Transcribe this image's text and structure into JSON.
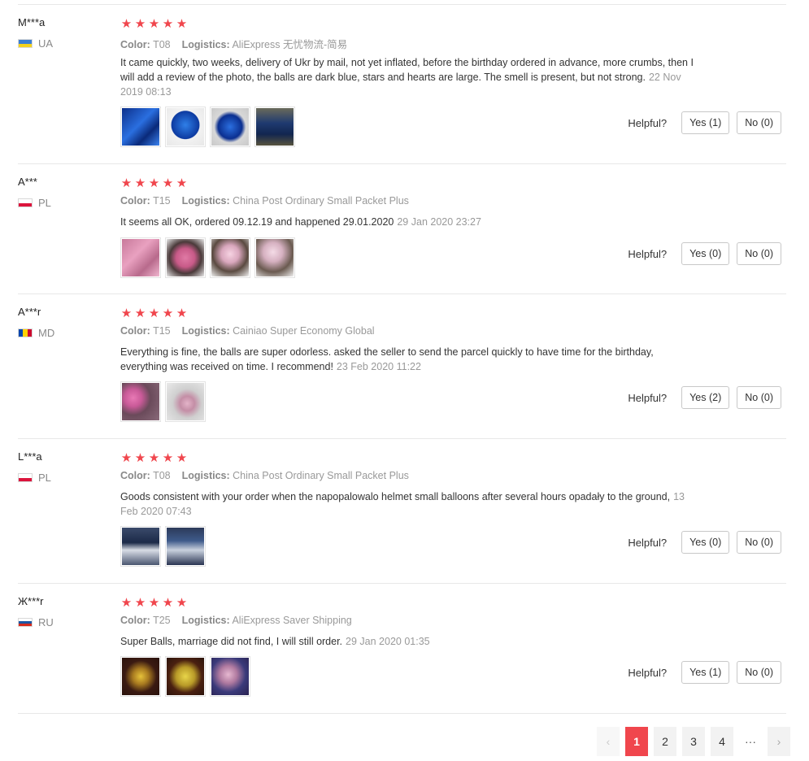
{
  "helpful_label": "Helpful?",
  "color_label": "Color:",
  "logistics_label": "Logistics:",
  "reviews": [
    {
      "user": "M***a",
      "country": "UA",
      "stars": 5,
      "color": "T08",
      "logistics": "AliExpress 无忧物流-简易",
      "text": "It came quickly, two weeks, delivery of Ukr by mail, not yet inflated, before the birthday ordered in advance, more crumbs, then I will add a review of the photo, the balls are dark blue, stars and hearts are large. The smell is present, but not strong.",
      "date": "22 Nov 2019 08:13",
      "yes": "Yes (1)",
      "no": "No (0)"
    },
    {
      "user": "A***",
      "country": "PL",
      "stars": 5,
      "color": "T15",
      "logistics": "China Post Ordinary Small Packet Plus",
      "text": "It seems all OK, ordered 09.12.19 and happened 29.01.2020",
      "date": "29 Jan 2020 23:27",
      "yes": "Yes (0)",
      "no": "No (0)"
    },
    {
      "user": "A***r",
      "country": "MD",
      "stars": 5,
      "color": "T15",
      "logistics": "Cainiao Super Economy Global",
      "text": "Everything is fine, the balls are super odorless. asked the seller to send the parcel quickly to have time for the birthday, everything was received on time. I recommend!",
      "date": "23 Feb 2020 11:22",
      "yes": "Yes (2)",
      "no": "No (0)"
    },
    {
      "user": "L***a",
      "country": "PL",
      "stars": 5,
      "color": "T08",
      "logistics": "China Post Ordinary Small Packet Plus",
      "text": "Goods consistent with your order when the napopalowalo helmet small balloons after several hours opadały to the ground,",
      "date": "13 Feb 2020 07:43",
      "yes": "Yes (0)",
      "no": "No (0)"
    },
    {
      "user": "Ж***r",
      "country": "RU",
      "stars": 5,
      "color": "T25",
      "logistics": "AliExpress Saver Shipping",
      "text": "Super Balls, marriage did not find, I will still order.",
      "date": "29 Jan 2020 01:35",
      "yes": "Yes (1)",
      "no": "No (0)"
    }
  ],
  "pagination": {
    "prev": "‹",
    "next": "›",
    "ellipsis": "···",
    "pages": [
      "1",
      "2",
      "3",
      "4"
    ],
    "current": "1"
  },
  "colors": {
    "accent": "#f0464d",
    "text_muted": "#999999",
    "border": "#e8e8e8"
  }
}
